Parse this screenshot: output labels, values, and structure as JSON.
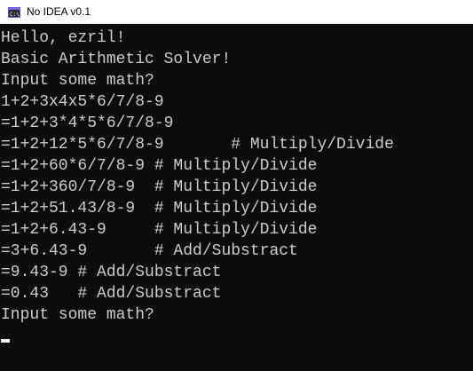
{
  "window": {
    "title": "No IDEA v0.1",
    "icon": "console-app-icon"
  },
  "console": {
    "lines": [
      "Hello, ezril!",
      "Basic Arithmetic Solver!",
      "Input some math?",
      "1+2+3x4x5*6/7/8-9",
      "=1+2+3*4*5*6/7/8-9",
      "=1+2+12*5*6/7/8-9       # Multiply/Divide",
      "=1+2+60*6/7/8-9 # Multiply/Divide",
      "=1+2+360/7/8-9  # Multiply/Divide",
      "=1+2+51.43/8-9  # Multiply/Divide",
      "=1+2+6.43-9     # Multiply/Divide",
      "=3+6.43-9       # Add/Substract",
      "=9.43-9 # Add/Substract",
      "=0.43   # Add/Substract",
      "Input some math?"
    ]
  },
  "colors": {
    "console_background": "#0c0c0c",
    "console_text": "#cccccc",
    "titlebar_background": "#ffffff"
  }
}
